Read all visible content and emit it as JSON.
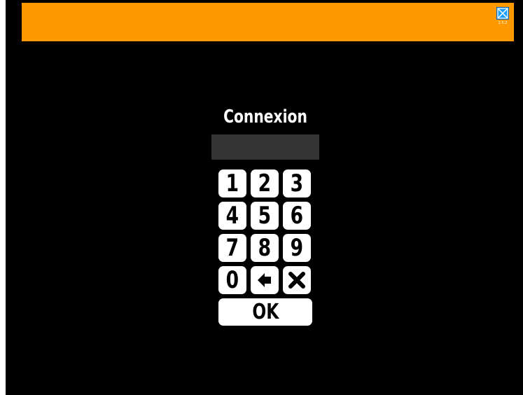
{
  "header": {
    "version": "2.5.2",
    "accent_color": "#ff9900",
    "close_icon": "close-box-icon",
    "close_icon_color": "#1a9fff"
  },
  "login": {
    "title": "Connexion",
    "pin_value": "",
    "keypad": {
      "k1": "1",
      "k2": "2",
      "k3": "3",
      "k4": "4",
      "k5": "5",
      "k6": "6",
      "k7": "7",
      "k8": "8",
      "k9": "9",
      "k0": "0",
      "backspace_icon": "arrow-left-icon",
      "clear_icon": "clear-x-icon"
    },
    "ok_label": "OK"
  }
}
